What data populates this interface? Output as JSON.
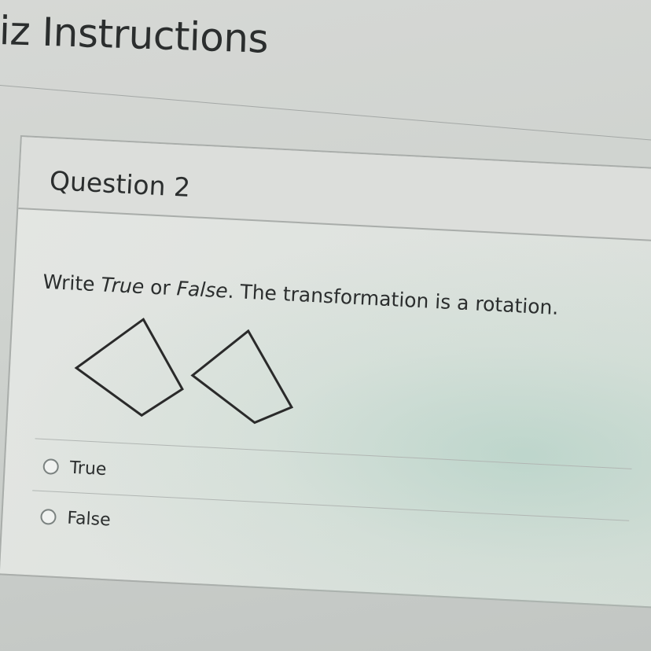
{
  "page": {
    "title": "iz Instructions"
  },
  "question": {
    "number_label": "Question 2",
    "prompt": {
      "prefix": "Write ",
      "true_word": "True",
      "middle": " or ",
      "false_word": "False",
      "suffix": ". The transformation is a rotation."
    },
    "options": [
      {
        "label": "True",
        "selected": false
      },
      {
        "label": "False",
        "selected": false
      }
    ]
  }
}
